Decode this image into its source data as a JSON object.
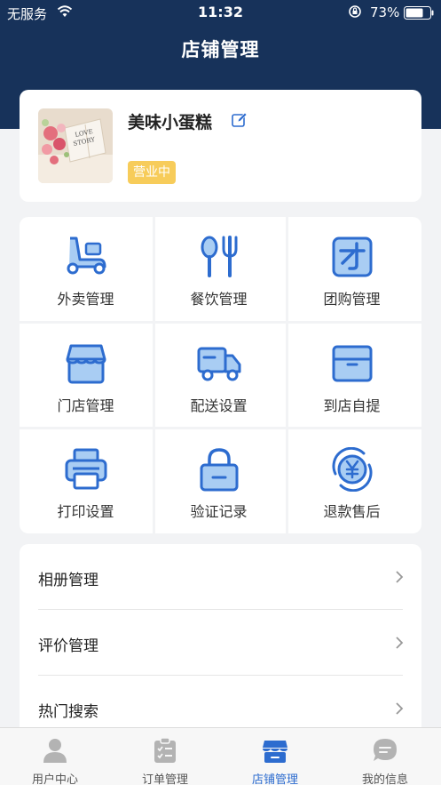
{
  "status_bar": {
    "carrier": "无服务",
    "time": "11:32",
    "battery_percent": "73%",
    "battery_level": 0.73
  },
  "nav": {
    "title": "店铺管理"
  },
  "store": {
    "name": "美味小蛋糕",
    "status": "营业中",
    "status_color": "#f7cc5a"
  },
  "grid": [
    {
      "label": "外卖管理",
      "icon": "scooter-icon"
    },
    {
      "label": "餐饮管理",
      "icon": "fork-spoon-icon"
    },
    {
      "label": "团购管理",
      "icon": "group-buy-icon"
    },
    {
      "label": "门店管理",
      "icon": "storefront-icon"
    },
    {
      "label": "配送设置",
      "icon": "delivery-truck-icon"
    },
    {
      "label": "到店自提",
      "icon": "box-icon"
    },
    {
      "label": "打印设置",
      "icon": "printer-icon"
    },
    {
      "label": "验证记录",
      "icon": "lock-icon"
    },
    {
      "label": "退款售后",
      "icon": "refund-yen-icon"
    }
  ],
  "menu_list": [
    {
      "label": "相册管理"
    },
    {
      "label": "评价管理"
    },
    {
      "label": "热门搜索"
    }
  ],
  "tabbar": [
    {
      "label": "用户中心",
      "icon": "user-icon",
      "active": false
    },
    {
      "label": "订单管理",
      "icon": "clipboard-icon",
      "active": false
    },
    {
      "label": "店铺管理",
      "icon": "store-icon",
      "active": true
    },
    {
      "label": "我的信息",
      "icon": "chat-icon",
      "active": false
    }
  ],
  "colors": {
    "header": "#17325a",
    "icon_blue": "#2d6ccf",
    "icon_fill": "#a9cdf3",
    "active_tab": "#2d6ccf"
  }
}
